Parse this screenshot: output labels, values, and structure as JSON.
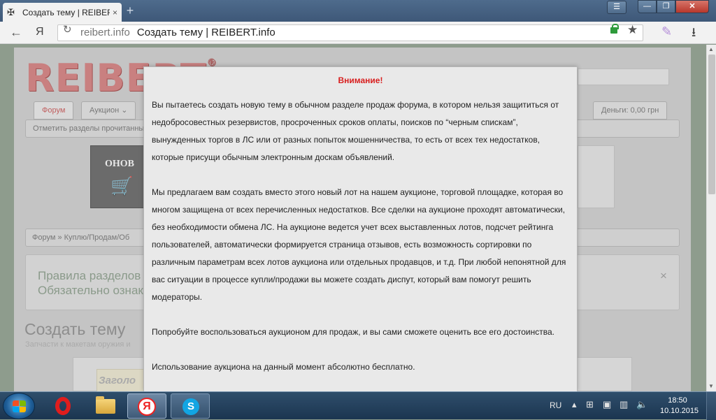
{
  "browser": {
    "tab_title": "Создать тему | REIBERT",
    "tab_close": "×",
    "new_tab": "+",
    "window_menu": "☰",
    "window_min": "—",
    "window_max": "❐",
    "window_close": "✕",
    "back": "←",
    "yandex_logo": "Я",
    "url_host": "reibert.info",
    "url_title": "Создать тему | REIBERT.info",
    "star": "★",
    "download": "⭳"
  },
  "page": {
    "logo": "REIBERT",
    "logo_reg": "®",
    "nav": {
      "forum": "Форум",
      "auction": "Аукцион ⌄",
      "money": "Деньги: 0,00 грн"
    },
    "subnav": "Отметить разделы прочитанными",
    "banner_text": "ОНОВ",
    "breadcrumb": "Форум  »  Куплю/Продам/Об",
    "rules_line1": "Правила разделов",
    "rules_line2": "Обязательно ознак",
    "rules_close": "×",
    "heading": "Создать тему",
    "subtitle": "Запчасти к макетам оружия и",
    "editor_placeholder": "Заголо"
  },
  "modal": {
    "title": "Внимание!",
    "p1": "Вы пытаетесь создать новую тему в обычном разделе продаж форума, в котором нельзя защититься от недобросовестных резервистов, просроченных сроков оплаты, поисков по “черным спискам”, вынужденных торгов в ЛС или от разных попыток мошенничества, то есть от всех тех недостатков, которые присущи обычным электронным доскам объявлений.",
    "p2": "Мы предлагаем вам создать вместо этого новый лот на нашем аукционе, торговой площадке, которая во многом защищена от всех перечисленных недостатков. Все сделки на аукционе проходят автоматически, без необходимости обмена ЛС. На аукционе ведется учет всех выставленных лотов, подсчет рейтинга пользователей, автоматически формируется страница отзывов, есть возможность сортировки по различным параметрам всех лотов аукциона или отдельных продавцов, и т.д. При любой непонятной для вас ситуации в процессе купли/продажи вы можете создать диспут, который вам помогут решить модераторы.",
    "p3": "Попробуйте воспользоваться аукционом для продаж, и вы сами сможете оценить все его достоинства.",
    "p4": "Использование аукциона на данный момент абсолютно бесплатно."
  },
  "taskbar": {
    "lang": "RU",
    "time": "18:50",
    "date": "10.10.2015",
    "yandex_letter": "Я",
    "skype_letter": "S"
  }
}
